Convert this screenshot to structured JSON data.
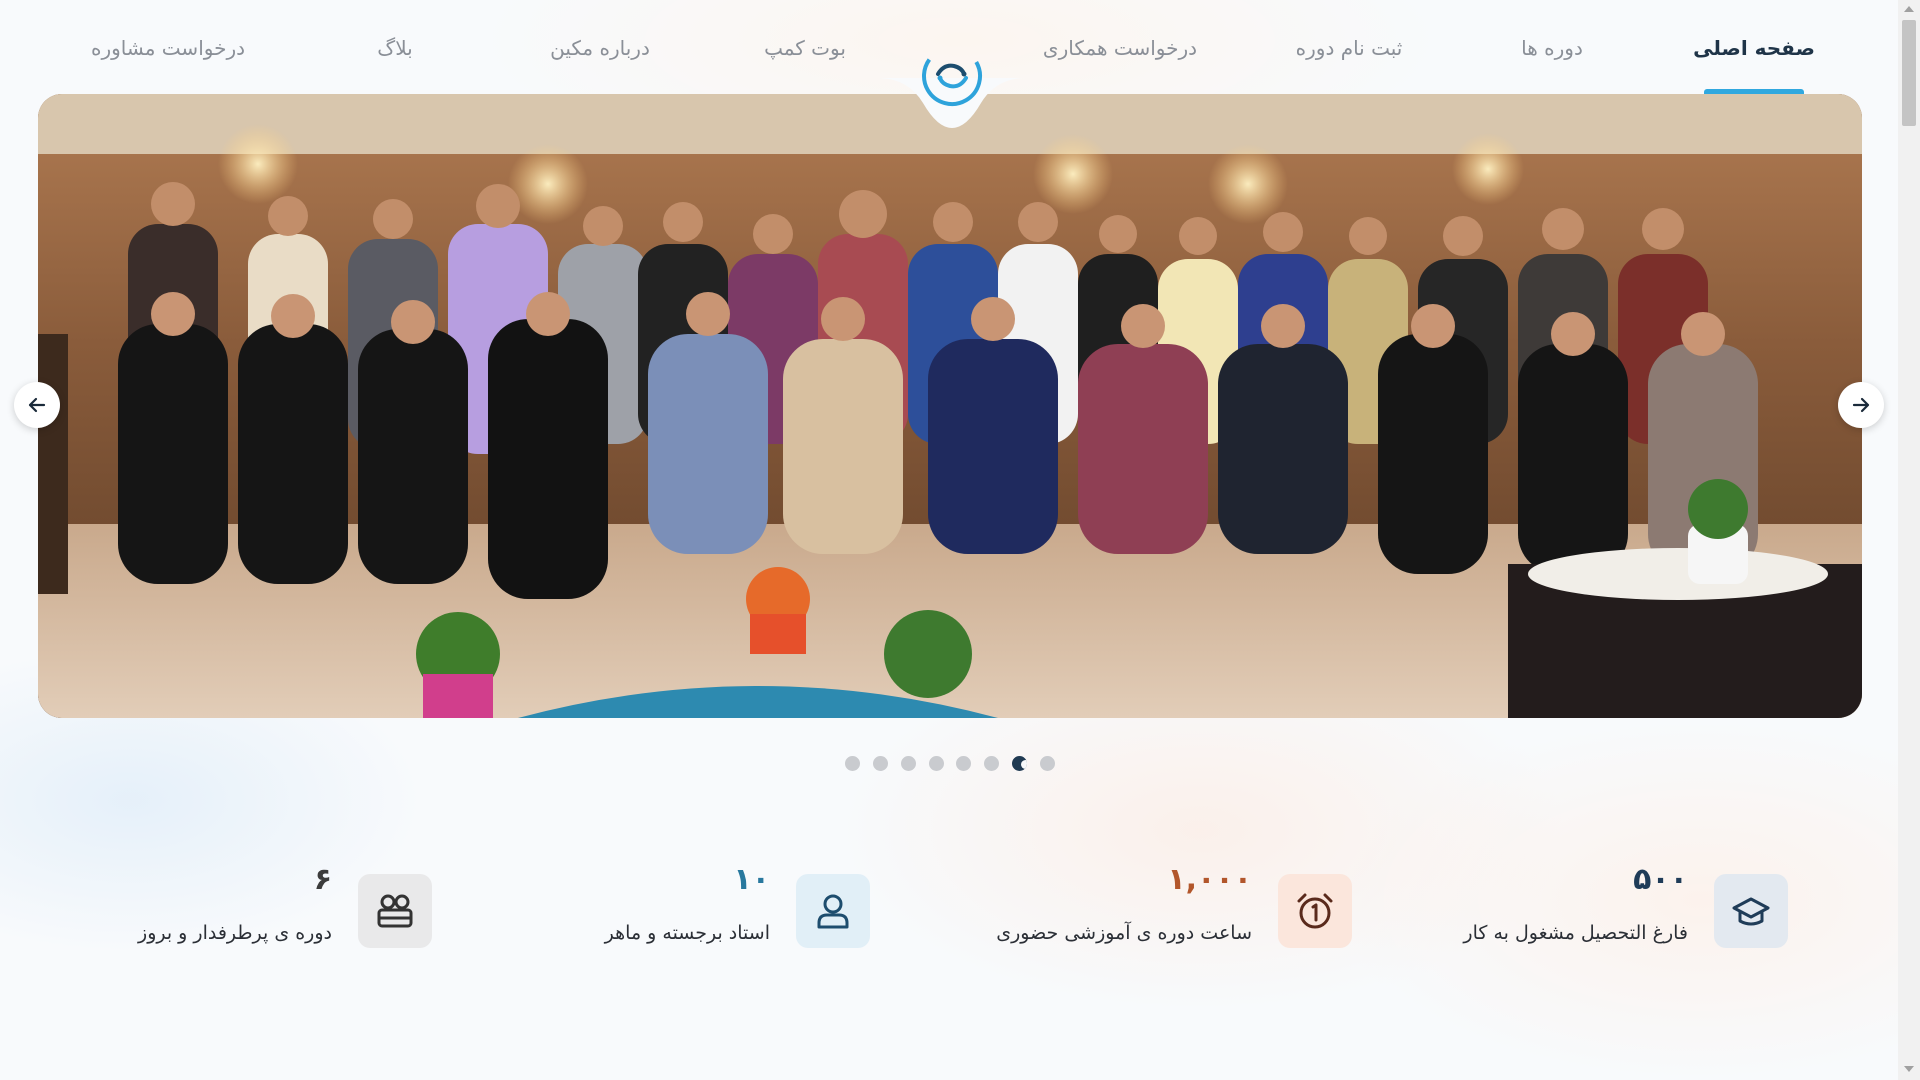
{
  "nav": {
    "items": [
      {
        "label": "صفحه اصلی",
        "active": true
      },
      {
        "label": "دوره ها"
      },
      {
        "label": "ثبت نام دوره"
      },
      {
        "label": "درخواست همکاری"
      },
      {
        "label": "بوت کمپ"
      },
      {
        "label": "درباره مکین"
      },
      {
        "label": "بلاگ"
      },
      {
        "label": "درخواست مشاوره"
      }
    ],
    "logo_icon": "circular-arrows-logo"
  },
  "slider": {
    "image": "group-photo-of-students-and-instructors",
    "prev_icon": "arrow-left-icon",
    "next_icon": "arrow-right-icon",
    "dot_count": 8,
    "active_dot": 7
  },
  "stats": [
    {
      "value": "۵۰۰",
      "label": "فارغ التحصیل مشغول به کار",
      "icon": "graduation-cap-icon",
      "color": "#1f3c58",
      "bg": "#e3e9f0"
    },
    {
      "value": "۱,۰۰۰",
      "label": "ساعت دوره ی آموزشی حضوری",
      "icon": "alarm-clock-icon",
      "color": "#b2562b",
      "bg": "#fbe6dc"
    },
    {
      "value": "۱۰",
      "label": "استاد برجسته و ماهر",
      "icon": "user-icon",
      "color": "#28789e",
      "bg": "#e1eff7"
    },
    {
      "value": "۶",
      "label": "دوره ی پرطرفدار و بروز",
      "icon": "film-camera-icon",
      "color": "#3c3c3c",
      "bg": "#e9e9ea"
    }
  ],
  "colors": {
    "accent": "#30a8df",
    "nav_active": "#1f3448",
    "nav_text": "#8a8f97"
  }
}
